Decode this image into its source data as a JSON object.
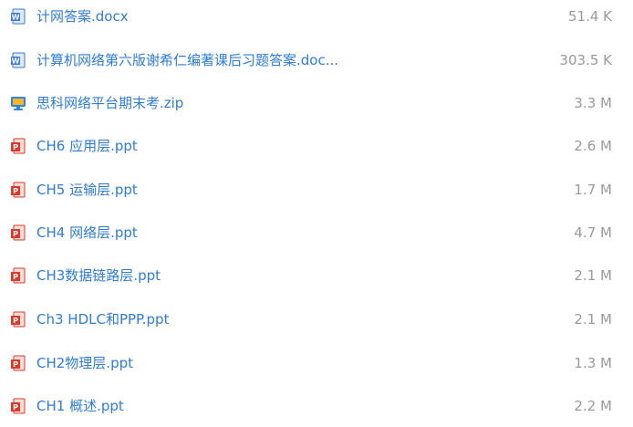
{
  "files": [
    {
      "name": "计网答案.docx",
      "size": "51.4 K",
      "icon": "word-doc-icon"
    },
    {
      "name": "计算机网络第六版谢希仁编著课后习题答案.doc...",
      "size": "303.5 K",
      "icon": "word-doc-icon"
    },
    {
      "name": "思科网络平台期末考.zip",
      "size": "3.3 M",
      "icon": "zip-archive-icon"
    },
    {
      "name": "CH6 应用层.ppt",
      "size": "2.6 M",
      "icon": "powerpoint-icon"
    },
    {
      "name": "CH5 运输层.ppt",
      "size": "1.7 M",
      "icon": "powerpoint-icon"
    },
    {
      "name": "CH4 网络层.ppt",
      "size": "4.7 M",
      "icon": "powerpoint-icon"
    },
    {
      "name": "CH3数据链路层.ppt",
      "size": "2.1 M",
      "icon": "powerpoint-icon"
    },
    {
      "name": "Ch3 HDLC和PPP.ppt",
      "size": "2.1 M",
      "icon": "powerpoint-icon"
    },
    {
      "name": "CH2物理层.ppt",
      "size": "1.3 M",
      "icon": "powerpoint-icon"
    },
    {
      "name": "CH1 概述.ppt",
      "size": "2.2 M",
      "icon": "powerpoint-icon"
    }
  ],
  "colors": {
    "link": "#2f7bd8",
    "size_text": "#9a9a9a",
    "word_blue": "#3d7ad6",
    "ppt_red": "#d83b2a",
    "zip_yellow": "#f2b628",
    "zip_blue": "#2f86d9"
  }
}
